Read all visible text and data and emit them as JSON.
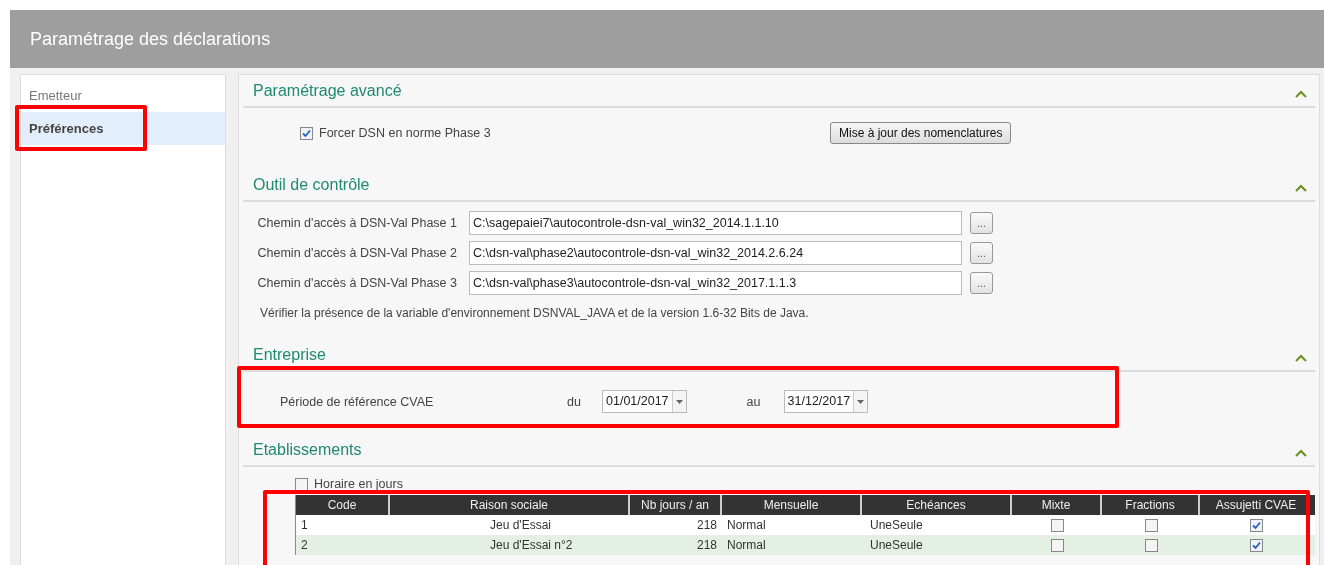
{
  "window": {
    "title": "Paramétrage des déclarations"
  },
  "sidebar": {
    "items": [
      {
        "label": "Emetteur",
        "selected": false
      },
      {
        "label": "Préférences",
        "selected": true
      }
    ]
  },
  "sections": [
    {
      "kind": "advanced",
      "title": "Paramétrage avancé",
      "expanded": true,
      "checkbox": {
        "label": "Forcer DSN en norme Phase 3",
        "checked": true
      },
      "button": "Mise à jour des nomenclatures"
    },
    {
      "kind": "tool",
      "title": "Outil de contrôle",
      "expanded": true,
      "paths": [
        {
          "label": "Chemin d'accès à DSN-Val Phase 1",
          "value": "C:\\sagepaiei7\\autocontrole-dsn-val_win32_2014.1.1.10",
          "button": "..."
        },
        {
          "label": "Chemin d'accès à DSN-Val Phase 2",
          "value": "C:\\dsn-val\\phase2\\autocontrole-dsn-val_win32_2014.2.6.24",
          "button": "..."
        },
        {
          "label": "Chemin d'accès à DSN-Val Phase 3",
          "value": "C:\\dsn-val\\phase3\\autocontrole-dsn-val_win32_2017.1.1.3",
          "button": "..."
        }
      ],
      "note": "Vérifier la présence de la variable d'environnement DSNVAL_JAVA et de la version 1.6-32 Bits de Java."
    },
    {
      "kind": "company",
      "title": "Entreprise",
      "expanded": true,
      "period": {
        "label": "Période de référence CVAE",
        "from_label": "du",
        "from": "01/01/2017",
        "to_label": "au",
        "to": "31/12/2017"
      }
    },
    {
      "kind": "establishments",
      "title": "Etablissements",
      "expanded": true,
      "checkbox": {
        "label": "Horaire en jours",
        "checked": false
      },
      "table": {
        "columns": [
          "Code",
          "Raison sociale",
          "Nb jours / an",
          "Mensuelle",
          "Echéances",
          "Mixte",
          "Fractions",
          "Assujetti CVAE"
        ],
        "rows": [
          {
            "code": "1",
            "name": "Jeu d'Essai",
            "days": "218",
            "monthly": "Normal",
            "deadlines": "UneSeule",
            "mixed": false,
            "fractions": false,
            "cvae": true
          },
          {
            "code": "2",
            "name": "Jeu d'Essai n°2",
            "days": "218",
            "monthly": "Normal",
            "deadlines": "UneSeule",
            "mixed": false,
            "fractions": false,
            "cvae": true
          }
        ]
      }
    }
  ]
}
